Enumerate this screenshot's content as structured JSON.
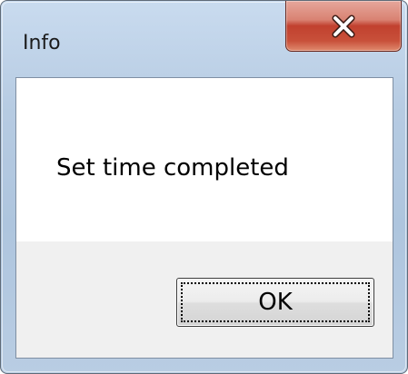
{
  "window": {
    "title": "Info"
  },
  "titlebar": {
    "close_icon": "close-x-icon"
  },
  "dialog": {
    "message": "Set time completed",
    "ok_label": "OK"
  },
  "colors": {
    "close_button": "#c1412f",
    "frame": "#b6cbe2",
    "content_bg": "#ffffff",
    "footer_bg": "#f0f0f0"
  }
}
